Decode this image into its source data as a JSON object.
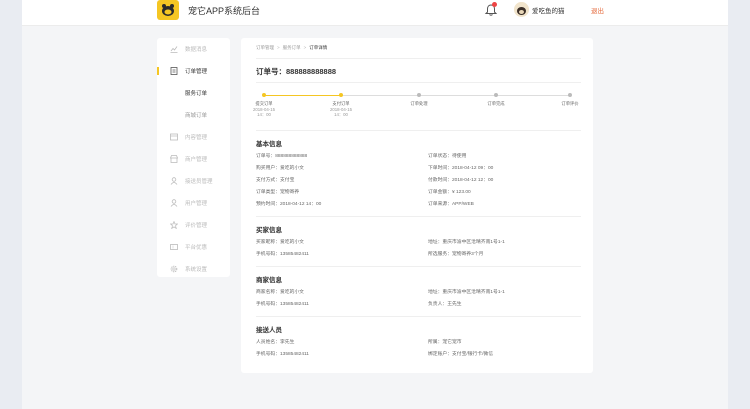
{
  "header": {
    "app_title": "宠它APP系统后台",
    "user_name": "爱吃鱼的猫",
    "logout_label": "退出"
  },
  "sidebar": {
    "items": [
      {
        "label": "数据消息",
        "icon": "chart-icon"
      },
      {
        "label": "订单管理",
        "icon": "order-icon",
        "active": true
      },
      {
        "label": "内容管理",
        "icon": "content-icon"
      },
      {
        "label": "商户管理",
        "icon": "merchant-icon"
      },
      {
        "label": "接送员管理",
        "icon": "courier-icon"
      },
      {
        "label": "用户管理",
        "icon": "user-icon"
      },
      {
        "label": "评价管理",
        "icon": "star-icon"
      },
      {
        "label": "平台优惠",
        "icon": "coupon-icon"
      },
      {
        "label": "系统设置",
        "icon": "gear-icon"
      }
    ],
    "sub_items": [
      {
        "label": "服务订单",
        "active": true
      },
      {
        "label": "商城订单",
        "active": false
      }
    ]
  },
  "breadcrumb": {
    "items": [
      "订单管理",
      "服务订单"
    ],
    "current": "订单详情",
    "sep": ">"
  },
  "order": {
    "title": "订单号：888888888888"
  },
  "steps": [
    {
      "name": "提交订单",
      "date": "2018-04-15",
      "time": "14：00",
      "done": true
    },
    {
      "name": "支付订单",
      "date": "2018-04-15",
      "time": "14：00",
      "done": true
    },
    {
      "name": "订单处理",
      "date": "",
      "time": "",
      "done": false
    },
    {
      "name": "订单完成",
      "date": "",
      "time": "",
      "done": false
    },
    {
      "name": "订单评价",
      "date": "",
      "time": "",
      "done": false
    }
  ],
  "basic": {
    "title": "基本信息",
    "left": [
      "订单号：888888888888",
      "购买用户：爱吃的小文",
      "支付方式：支付宝",
      "订单类型：宠物寄养",
      "预约时间：2018-04-12  14：00"
    ],
    "right": [
      "订单状态：待使用",
      "下单时间：2018-04-12  09：00",
      "付款时间：2018-04-12  12：00",
      "订单金额：¥ 123.00",
      "订单来源：APP/WEB"
    ]
  },
  "buyer": {
    "title": "买家信息",
    "left": [
      "买家昵称：爱吃的小文",
      "手机号码：13585482411"
    ],
    "right": [
      "地址：重庆市渝中区沧晴齐南1号1-1",
      "所选服务：宠物寄养3个月"
    ]
  },
  "seller": {
    "title": "商家信息",
    "left": [
      "商家名称：爱吃的小文",
      "手机号码：13585482411"
    ],
    "right": [
      "地址：重庆市渝中区沧晴齐南1号1-1",
      "负责人：王先生"
    ]
  },
  "courier": {
    "title": "接送人员",
    "left": [
      "人员姓名：李先生",
      "手机号码：13585482411"
    ],
    "right": [
      "所属：宠它宠市",
      "绑定账户：支付宝/银行卡/微信"
    ]
  },
  "colors": {
    "accent": "#f5c623",
    "logout": "#e4683a",
    "badge": "#ee4444"
  }
}
